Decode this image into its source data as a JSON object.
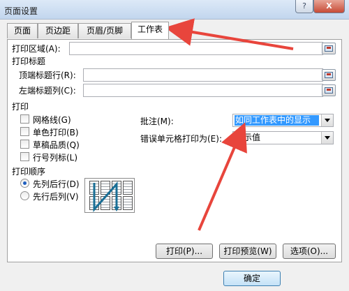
{
  "window": {
    "title": "页面设置",
    "help_label": "?",
    "close_label": "X"
  },
  "tabs": [
    {
      "label": "页面",
      "active": false
    },
    {
      "label": "页边距",
      "active": false
    },
    {
      "label": "页眉/页脚",
      "active": false
    },
    {
      "label": "工作表",
      "active": true
    }
  ],
  "print_area": {
    "label": "打印区域(A):",
    "value": ""
  },
  "print_titles": {
    "section_label": "打印标题",
    "top_rows_label": "顶端标题行(R):",
    "top_rows_value": "",
    "left_cols_label": "左端标题列(C):",
    "left_cols_value": ""
  },
  "print": {
    "section_label": "打印",
    "options": [
      {
        "label": "网格线(G)",
        "checked": false
      },
      {
        "label": "单色打印(B)",
        "checked": false
      },
      {
        "label": "草稿品质(Q)",
        "checked": false
      },
      {
        "label": "行号列标(L)",
        "checked": false
      }
    ],
    "comments_label": "批注(M):",
    "comments_value": "如同工作表中的显示",
    "errors_label": "错误单元格打印为(E):",
    "errors_value": "显示值"
  },
  "page_order": {
    "section_label": "打印顺序",
    "options": [
      {
        "label": "先列后行(D)",
        "checked": true
      },
      {
        "label": "先行后列(V)",
        "checked": false
      }
    ]
  },
  "buttons": {
    "print": "打印(P)...",
    "preview": "打印预览(W)",
    "options": "选项(O)...",
    "ok": "确定"
  },
  "accent": {
    "annotation_arrow": "#e8453c",
    "selection": "#3399ff"
  }
}
